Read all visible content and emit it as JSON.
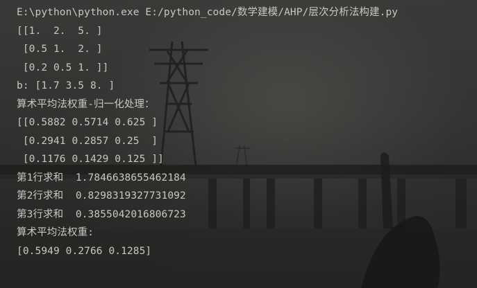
{
  "console": {
    "lines": [
      "E:\\python\\python.exe E:/python_code/数学建模/AHP/层次分析法构建.py",
      "[[1.  2.  5. ]",
      " [0.5 1.  2. ]",
      " [0.2 0.5 1. ]]",
      "b: [1.7 3.5 8. ]",
      "算术平均法权重-归一化处理：",
      "[[0.5882 0.5714 0.625 ]",
      " [0.2941 0.2857 0.25  ]",
      " [0.1176 0.1429 0.125 ]]",
      "第1行求和  1.7846638655462184",
      "第2行求和  0.8298319327731092",
      "第3行求和  0.3855042016806723",
      "算术平均法权重:",
      "[0.5949 0.2766 0.1285]"
    ]
  }
}
